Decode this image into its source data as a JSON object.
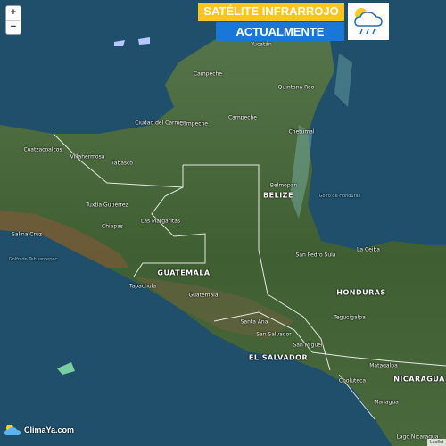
{
  "controls": {
    "zoom_in": "+",
    "zoom_out": "−"
  },
  "banner": {
    "line1": "SATÉLITE INFRARROJO",
    "line2": "ACTUALMENTE",
    "weather_icon": "sun-cloud-rain-icon"
  },
  "logo": {
    "text": "ClimaYa.com",
    "icon": "cloud-sun-icon"
  },
  "attribution": "Leaflet",
  "colors": {
    "banner_yellow": "#ffc41f",
    "banner_blue": "#1977d8",
    "sea": "#1f4f6a",
    "land": "#4b6a3a",
    "border": "#ffffff"
  },
  "labels": {
    "countries": {
      "guatemala": "GUATEMALA",
      "belize": "BELIZE",
      "honduras": "HONDURAS",
      "el_salvador": "EL SALVADOR",
      "nicaragua": "NICARAGUA"
    },
    "places": {
      "yucatan": "Yucatán",
      "campeche1": "Campeche",
      "campeche2": "Campeche",
      "campeche3": "Campeche",
      "quintana_roo": "Quintana Roo",
      "ciudad_del_carmen": "Ciudad del Carmen",
      "chetumal": "Chetumal",
      "coatzacoalcos": "Coatzacoalcos",
      "villahermosa": "Villahermosa",
      "tabasco": "Tabasco",
      "belmopan": "Belmopan",
      "tuxtla": "Tuxtla Gutiérrez",
      "chiapas": "Chiapas",
      "las_margaritas": "Las Margaritas",
      "tapachula": "Tapachula",
      "guatemala_city": "Guatemala",
      "san_pedro_sula": "San Pedro Sula",
      "la_ceiba": "La Ceiba",
      "santa_ana": "Santa Ana",
      "san_salvador": "San Salvador",
      "san_miguel": "San Miguel",
      "tegucigalpa": "Tegucigalpa",
      "choluteca": "Choluteca",
      "matagalpa": "Matagalpa",
      "managua": "Managua",
      "lago_nicaragua": "Lago Nicaragua",
      "salina_cruz": "Salina Cruz"
    },
    "water": {
      "golfo_honduras": "Golfo de Honduras",
      "golfo_tehuantepec": "Golfo de Tehuantepec"
    }
  }
}
